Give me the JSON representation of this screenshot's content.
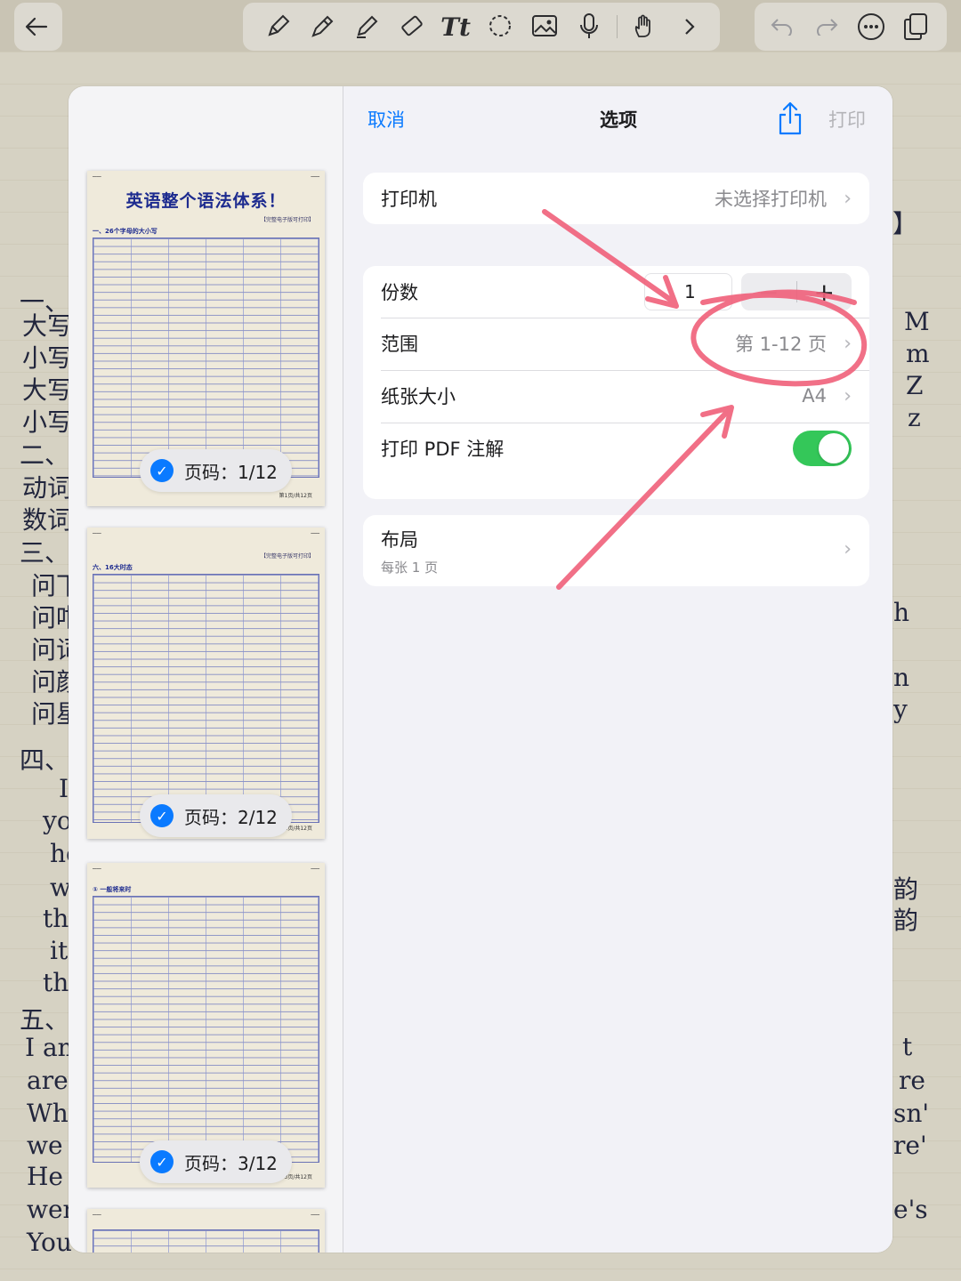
{
  "background": {
    "notebook_left_text": [
      "一、",
      "大写",
      "小写",
      "大写",
      "小写",
      "二、",
      "动词",
      "数词",
      "三、",
      "问下",
      "问咁",
      "问词",
      "问颜",
      "问星",
      "四、",
      "I",
      "you",
      "he",
      "w",
      "th",
      "it",
      "th",
      "五、",
      "I am",
      "are",
      "Wh",
      "we",
      "He",
      "wer",
      "You"
    ],
    "notebook_right_text": [
      "】",
      "M",
      "m",
      "Z",
      "z",
      "h",
      "n",
      "y",
      "韵",
      "韵",
      "t",
      "re",
      "sn'",
      "re'",
      "e's"
    ]
  },
  "toolbar": {
    "back_icon": "back-arrow-icon",
    "tools": [
      "pen-icon",
      "pen-icon",
      "highlighter-icon",
      "eraser-icon",
      "text-tool-icon",
      "lasso-icon",
      "image-icon",
      "microphone-icon",
      "hand-draw-icon",
      "more-tools-chevron-icon"
    ],
    "text_tool_label": "Tt",
    "right_tools": [
      "undo-icon",
      "redo-icon",
      "more-icon",
      "pages-icon"
    ]
  },
  "print_sheet": {
    "cancel": "取消",
    "title": "选项",
    "print": "打印",
    "printer_label": "打印机",
    "printer_value": "未选择打印机",
    "copies_label": "份数",
    "copies_value": "1",
    "minus": "−",
    "plus": "+",
    "range_label": "范围",
    "range_value": "第 1-12 页",
    "paper_label": "纸张大小",
    "paper_value": "A4",
    "annotations_label": "打印 PDF 注解",
    "annotations_on": true,
    "layout_label": "布局",
    "layout_sub": "每张 1 页",
    "accent_color": "#0A7AFF",
    "toggle_color": "#34C759",
    "annotation_color": "#F0607A"
  },
  "preview": {
    "pages": [
      {
        "badge": "页码：1/12",
        "title": "英语整个语法体系！",
        "sub": "【完整电子版可打印】",
        "sec1": "一、26个字母的大小写",
        "footer": "第1页/共12页"
      },
      {
        "badge": "页码：2/12",
        "title": "",
        "sub": "【完整电子版可打印】",
        "sec1": "六、16大时态",
        "footer": "第2页/共12页"
      },
      {
        "badge": "页码：3/12",
        "title": "",
        "sub": "",
        "sec1": "① 一般将来时",
        "footer": "第3页/共12页"
      }
    ]
  }
}
